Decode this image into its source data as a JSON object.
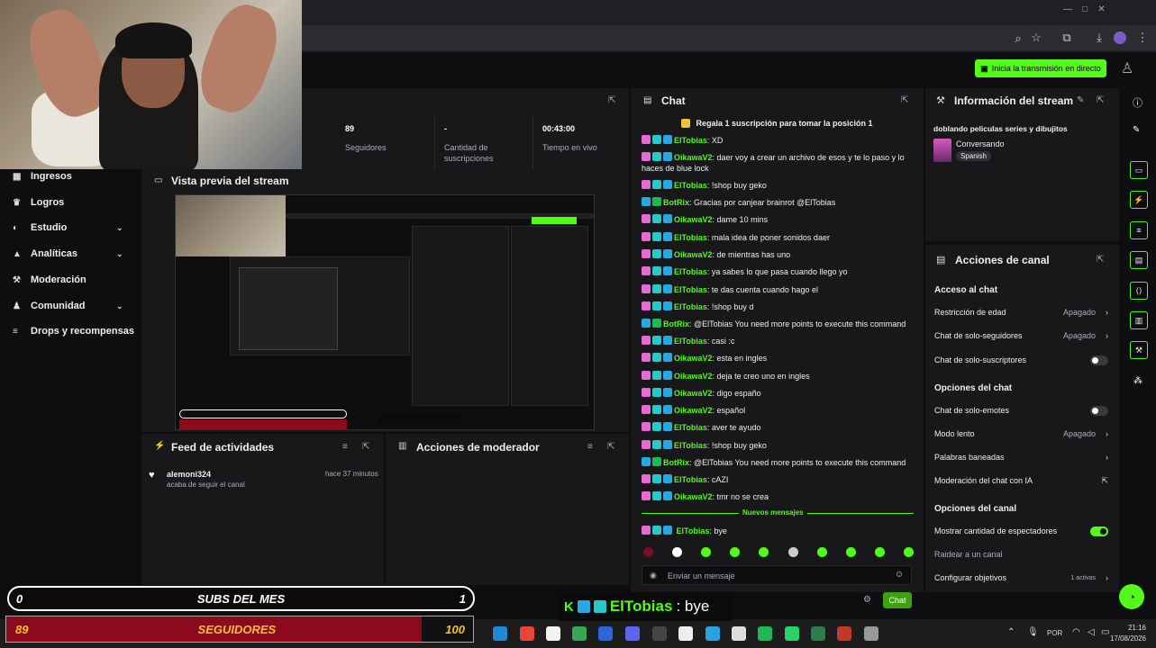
{
  "browser": {
    "toolbar_icons": [
      "zoom-icon",
      "star-icon",
      "extensions-icon",
      "download-icon",
      "profile-icon",
      "menu-icon"
    ]
  },
  "topbar": {
    "go_live_label": "Inicia la transmisión en directo"
  },
  "leftnav": {
    "items": [
      {
        "label": "Ingresos",
        "icon": "bank-icon",
        "chevron": false
      },
      {
        "label": "Logros",
        "icon": "trophy-icon",
        "chevron": false
      },
      {
        "label": "Estudio",
        "icon": "studio-icon",
        "chevron": true
      },
      {
        "label": "Analíticas",
        "icon": "chart-icon",
        "chevron": true
      },
      {
        "label": "Moderación",
        "icon": "hammer-icon",
        "chevron": false
      },
      {
        "label": "Comunidad",
        "icon": "people-icon",
        "chevron": true
      },
      {
        "label": "Drops y recompensas",
        "icon": "list-icon",
        "chevron": false
      }
    ]
  },
  "stats": {
    "cells": [
      {
        "value": "89",
        "label": "Seguidores"
      },
      {
        "value": "-",
        "label": "Cantidad de suscripciones"
      },
      {
        "value": "00:43:00",
        "label": "Tiempo en vivo"
      }
    ]
  },
  "preview": {
    "title": "Vista previa del stream"
  },
  "feed": {
    "title": "Feed de actividades",
    "items": [
      {
        "user": "alemoni324",
        "action": "acaba de seguir el canal",
        "time": "hace 37 minutos"
      }
    ]
  },
  "modactions": {
    "title": "Acciones de moderador"
  },
  "chat": {
    "title": "Chat",
    "pinned": "Regala 1 suscripción para tomar la posición 1",
    "messages": [
      {
        "user": "ElTobias",
        "text": "XD",
        "color": "#53fc18",
        "kind": "user"
      },
      {
        "user": "OikawaV2",
        "text": "daer voy a crear un archivo de esos y te lo paso y lo haces de blue lock",
        "color": "#53fc18",
        "kind": "user"
      },
      {
        "user": "ElTobias",
        "text": "!shop buy geko",
        "color": "#53fc18",
        "kind": "user"
      },
      {
        "user": "BotRix",
        "text": "Gracias por canjear brainrot @ElTobias",
        "color": "#53fc18",
        "kind": "bot"
      },
      {
        "user": "OikawaV2",
        "text": "dame 10 mins",
        "color": "#53fc18",
        "kind": "user"
      },
      {
        "user": "ElTobias",
        "text": "mala idea de poner sonidos daer",
        "color": "#53fc18",
        "kind": "user"
      },
      {
        "user": "OikawaV2",
        "text": "de mientras has uno",
        "color": "#53fc18",
        "kind": "user"
      },
      {
        "user": "ElTobias",
        "text": "ya sabes lo que pasa cuando llego yo",
        "color": "#53fc18",
        "kind": "user"
      },
      {
        "user": "ElTobias",
        "text": "te das cuenta cuando hago el",
        "color": "#53fc18",
        "kind": "user"
      },
      {
        "user": "ElTobias",
        "text": "!shop buy d",
        "color": "#53fc18",
        "kind": "user"
      },
      {
        "user": "BotRix",
        "text": "@ElTobias You need more points to execute this command",
        "color": "#53fc18",
        "kind": "bot"
      },
      {
        "user": "ElTobias",
        "text": "casi :c",
        "color": "#53fc18",
        "kind": "user"
      },
      {
        "user": "OikawaV2",
        "text": "esta en ingles",
        "color": "#53fc18",
        "kind": "user"
      },
      {
        "user": "OikawaV2",
        "text": "deja te creo uno en ingles",
        "color": "#53fc18",
        "kind": "user"
      },
      {
        "user": "OikawaV2",
        "text": "digo españo",
        "color": "#53fc18",
        "kind": "user"
      },
      {
        "user": "OikawaV2",
        "text": "español",
        "color": "#53fc18",
        "kind": "user"
      },
      {
        "user": "ElTobias",
        "text": "aver te ayudo",
        "color": "#53fc18",
        "kind": "user"
      },
      {
        "user": "ElTobias",
        "text": "!shop buy geko",
        "color": "#53fc18",
        "kind": "user"
      },
      {
        "user": "BotRix",
        "text": "@ElTobias You need more points to execute this command",
        "color": "#53fc18",
        "kind": "bot"
      },
      {
        "user": "ElTobias",
        "text": "cAZI",
        "color": "#53fc18",
        "kind": "user"
      },
      {
        "user": "OikawaV2",
        "text": "tmr no se crea",
        "color": "#53fc18",
        "kind": "user"
      }
    ],
    "new_messages_label": "Nuevos mensajes",
    "last_message": {
      "user": "ElTobias",
      "text": "bye"
    },
    "input_placeholder": "Enviar un mensaje",
    "send_label": "Chat"
  },
  "info": {
    "title": "Información del stream",
    "stream_title": "doblando peliculas series y dibujitos",
    "category": "Conversando",
    "language": "Spanish"
  },
  "actions": {
    "title": "Acciones de canal",
    "sections": [
      {
        "heading": "Acceso al chat",
        "rows": [
          {
            "label": "Restricción de edad",
            "value": "Apagado",
            "control": "chevron"
          },
          {
            "label": "Chat de solo-seguidores",
            "value": "Apagado",
            "control": "chevron"
          },
          {
            "label": "Chat de solo-suscriptores",
            "value": "",
            "control": "toggle-off"
          }
        ]
      },
      {
        "heading": "Opciones del chat",
        "rows": [
          {
            "label": "Chat de solo-emotes",
            "value": "",
            "control": "toggle-off"
          },
          {
            "label": "Modo lento",
            "value": "Apagado",
            "control": "chevron"
          },
          {
            "label": "Palabras baneadas",
            "value": "",
            "control": "chevron"
          },
          {
            "label": "Moderación del chat con IA",
            "value": "",
            "control": "external"
          }
        ]
      },
      {
        "heading": "Opciones del canal",
        "rows": [
          {
            "label": "Mostrar cantidad de espectadores",
            "value": "",
            "control": "toggle-on"
          },
          {
            "label": "Raidear a un canal",
            "value": "",
            "control": "none"
          },
          {
            "label": "Configurar objetivos",
            "value": "1 activas",
            "control": "chevron"
          }
        ]
      }
    ]
  },
  "overlay": {
    "subs_label": "SUBS DEL MES",
    "subs_current": "0",
    "subs_goal": "1",
    "followers_label": "SEGUIDORES",
    "followers_current": "89",
    "followers_goal": "100",
    "followers_progress": 0.89,
    "message_user": "ElTobias",
    "message_text": ": bye"
  },
  "taskbar": {
    "lang": "POR",
    "time": "21:16",
    "date": "17/08/2026"
  },
  "colors": {
    "accent": "#53fc18",
    "panel": "#18181b",
    "bg": "#0e0e10",
    "follower_bar": "#8b0a1c"
  }
}
